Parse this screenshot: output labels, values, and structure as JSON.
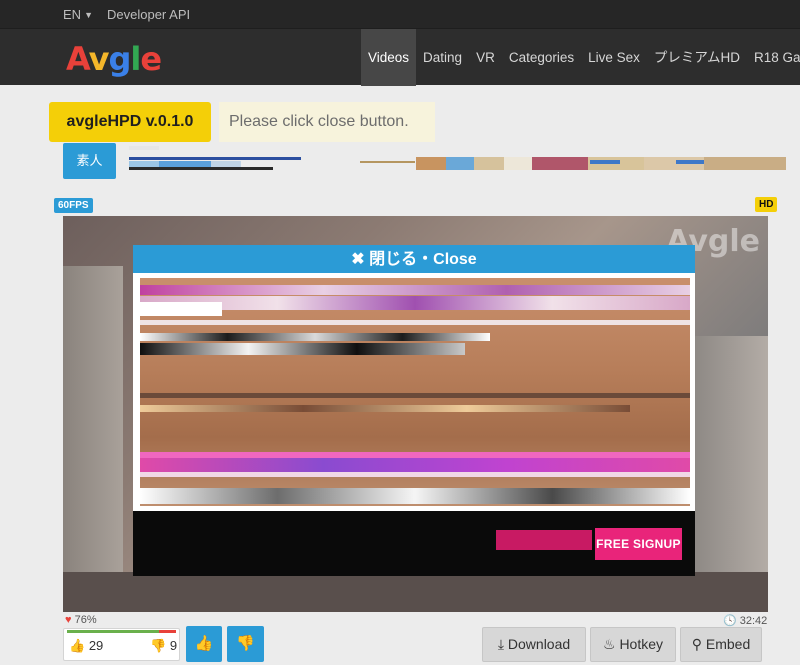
{
  "topbar": {
    "language": "EN",
    "developer_api": "Developer API"
  },
  "logo": {
    "letters": [
      "A",
      "v",
      "g",
      "l",
      "e"
    ]
  },
  "nav": {
    "items": [
      "Videos",
      "Dating",
      "VR",
      "Categories",
      "Live Sex",
      "プレミアムHD",
      "R18 Gam"
    ],
    "active": "Videos"
  },
  "hpd": {
    "badge": "avgleHPD v.0.1.0",
    "message": "Please click close button."
  },
  "tag": {
    "label": "素人"
  },
  "video": {
    "fps_badge": "60FPS",
    "hd_badge": "HD",
    "watermark": "Avgle",
    "close_label": "✖ 閉じる・Close",
    "signup_label": "FREE SIGNUP",
    "rating": "76%",
    "duration": "32:42",
    "likes": "29",
    "dislikes": "9"
  },
  "actions": {
    "download": "Download",
    "hotkey": "Hotkey",
    "embed": "Embed"
  },
  "colors": {
    "accent_blue": "#2b9bd6",
    "badge_yellow": "#f4cf08",
    "signup_pink": "#e9247a"
  }
}
